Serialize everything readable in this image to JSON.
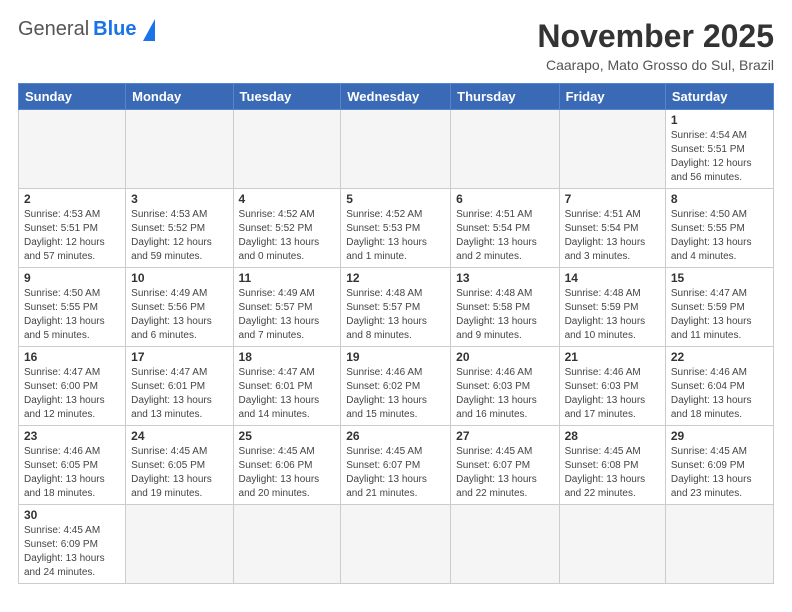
{
  "header": {
    "logo": {
      "general": "General",
      "blue": "Blue"
    },
    "title": "November 2025",
    "subtitle": "Caarapo, Mato Grosso do Sul, Brazil"
  },
  "weekdays": [
    "Sunday",
    "Monday",
    "Tuesday",
    "Wednesday",
    "Thursday",
    "Friday",
    "Saturday"
  ],
  "weeks": [
    [
      {
        "day": "",
        "info": ""
      },
      {
        "day": "",
        "info": ""
      },
      {
        "day": "",
        "info": ""
      },
      {
        "day": "",
        "info": ""
      },
      {
        "day": "",
        "info": ""
      },
      {
        "day": "",
        "info": ""
      },
      {
        "day": "1",
        "info": "Sunrise: 4:54 AM\nSunset: 5:51 PM\nDaylight: 12 hours and 56 minutes."
      }
    ],
    [
      {
        "day": "2",
        "info": "Sunrise: 4:53 AM\nSunset: 5:51 PM\nDaylight: 12 hours and 57 minutes."
      },
      {
        "day": "3",
        "info": "Sunrise: 4:53 AM\nSunset: 5:52 PM\nDaylight: 12 hours and 59 minutes."
      },
      {
        "day": "4",
        "info": "Sunrise: 4:52 AM\nSunset: 5:52 PM\nDaylight: 13 hours and 0 minutes."
      },
      {
        "day": "5",
        "info": "Sunrise: 4:52 AM\nSunset: 5:53 PM\nDaylight: 13 hours and 1 minute."
      },
      {
        "day": "6",
        "info": "Sunrise: 4:51 AM\nSunset: 5:54 PM\nDaylight: 13 hours and 2 minutes."
      },
      {
        "day": "7",
        "info": "Sunrise: 4:51 AM\nSunset: 5:54 PM\nDaylight: 13 hours and 3 minutes."
      },
      {
        "day": "8",
        "info": "Sunrise: 4:50 AM\nSunset: 5:55 PM\nDaylight: 13 hours and 4 minutes."
      }
    ],
    [
      {
        "day": "9",
        "info": "Sunrise: 4:50 AM\nSunset: 5:55 PM\nDaylight: 13 hours and 5 minutes."
      },
      {
        "day": "10",
        "info": "Sunrise: 4:49 AM\nSunset: 5:56 PM\nDaylight: 13 hours and 6 minutes."
      },
      {
        "day": "11",
        "info": "Sunrise: 4:49 AM\nSunset: 5:57 PM\nDaylight: 13 hours and 7 minutes."
      },
      {
        "day": "12",
        "info": "Sunrise: 4:48 AM\nSunset: 5:57 PM\nDaylight: 13 hours and 8 minutes."
      },
      {
        "day": "13",
        "info": "Sunrise: 4:48 AM\nSunset: 5:58 PM\nDaylight: 13 hours and 9 minutes."
      },
      {
        "day": "14",
        "info": "Sunrise: 4:48 AM\nSunset: 5:59 PM\nDaylight: 13 hours and 10 minutes."
      },
      {
        "day": "15",
        "info": "Sunrise: 4:47 AM\nSunset: 5:59 PM\nDaylight: 13 hours and 11 minutes."
      }
    ],
    [
      {
        "day": "16",
        "info": "Sunrise: 4:47 AM\nSunset: 6:00 PM\nDaylight: 13 hours and 12 minutes."
      },
      {
        "day": "17",
        "info": "Sunrise: 4:47 AM\nSunset: 6:01 PM\nDaylight: 13 hours and 13 minutes."
      },
      {
        "day": "18",
        "info": "Sunrise: 4:47 AM\nSunset: 6:01 PM\nDaylight: 13 hours and 14 minutes."
      },
      {
        "day": "19",
        "info": "Sunrise: 4:46 AM\nSunset: 6:02 PM\nDaylight: 13 hours and 15 minutes."
      },
      {
        "day": "20",
        "info": "Sunrise: 4:46 AM\nSunset: 6:03 PM\nDaylight: 13 hours and 16 minutes."
      },
      {
        "day": "21",
        "info": "Sunrise: 4:46 AM\nSunset: 6:03 PM\nDaylight: 13 hours and 17 minutes."
      },
      {
        "day": "22",
        "info": "Sunrise: 4:46 AM\nSunset: 6:04 PM\nDaylight: 13 hours and 18 minutes."
      }
    ],
    [
      {
        "day": "23",
        "info": "Sunrise: 4:46 AM\nSunset: 6:05 PM\nDaylight: 13 hours and 18 minutes."
      },
      {
        "day": "24",
        "info": "Sunrise: 4:45 AM\nSunset: 6:05 PM\nDaylight: 13 hours and 19 minutes."
      },
      {
        "day": "25",
        "info": "Sunrise: 4:45 AM\nSunset: 6:06 PM\nDaylight: 13 hours and 20 minutes."
      },
      {
        "day": "26",
        "info": "Sunrise: 4:45 AM\nSunset: 6:07 PM\nDaylight: 13 hours and 21 minutes."
      },
      {
        "day": "27",
        "info": "Sunrise: 4:45 AM\nSunset: 6:07 PM\nDaylight: 13 hours and 22 minutes."
      },
      {
        "day": "28",
        "info": "Sunrise: 4:45 AM\nSunset: 6:08 PM\nDaylight: 13 hours and 22 minutes."
      },
      {
        "day": "29",
        "info": "Sunrise: 4:45 AM\nSunset: 6:09 PM\nDaylight: 13 hours and 23 minutes."
      }
    ],
    [
      {
        "day": "30",
        "info": "Sunrise: 4:45 AM\nSunset: 6:09 PM\nDaylight: 13 hours and 24 minutes."
      },
      {
        "day": "",
        "info": ""
      },
      {
        "day": "",
        "info": ""
      },
      {
        "day": "",
        "info": ""
      },
      {
        "day": "",
        "info": ""
      },
      {
        "day": "",
        "info": ""
      },
      {
        "day": "",
        "info": ""
      }
    ]
  ]
}
